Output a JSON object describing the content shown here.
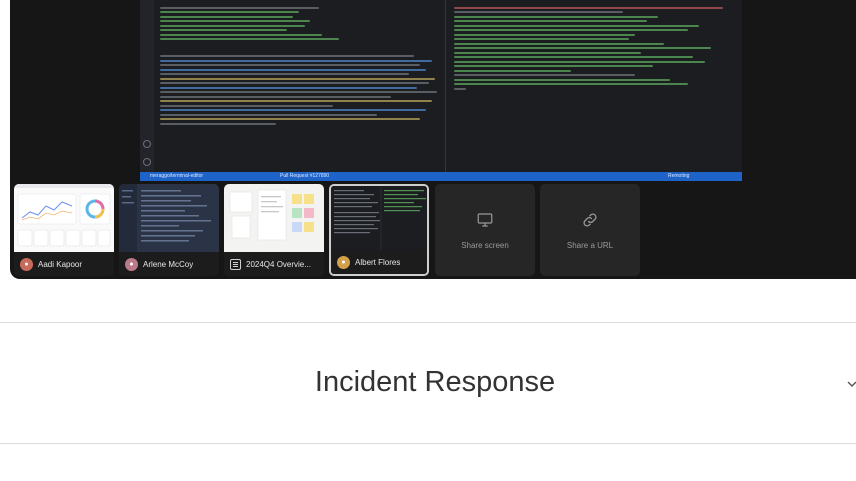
{
  "status_bar": {
    "branch": "meraggo/terminal-editor",
    "pull_request": "Pull Request #127890",
    "right_status": "Remoting"
  },
  "participants": [
    {
      "name": "Aadi Kapoor",
      "avatar_color": "#c96b5a",
      "icon": "avatar",
      "active": false
    },
    {
      "name": "Arlene McCoy",
      "avatar_color": "#b97a8a",
      "icon": "avatar",
      "active": false
    },
    {
      "name": "2024Q4 Overvie...",
      "avatar_color": "",
      "icon": "document-icon",
      "active": false
    },
    {
      "name": "Albert Flores",
      "avatar_color": "#d4a04a",
      "icon": "avatar",
      "active": true
    }
  ],
  "actions": {
    "share_screen": {
      "label": "Share screen",
      "icon": "monitor-icon"
    },
    "share_url": {
      "label": "Share a URL",
      "icon": "link-icon"
    }
  },
  "section": {
    "title": "Incident Response",
    "toggle_icon": "chevron-down-icon"
  },
  "colors": {
    "panel_bg": "#161616",
    "status_bar": "#1e64c8",
    "active_border": "#cfcfcf"
  }
}
